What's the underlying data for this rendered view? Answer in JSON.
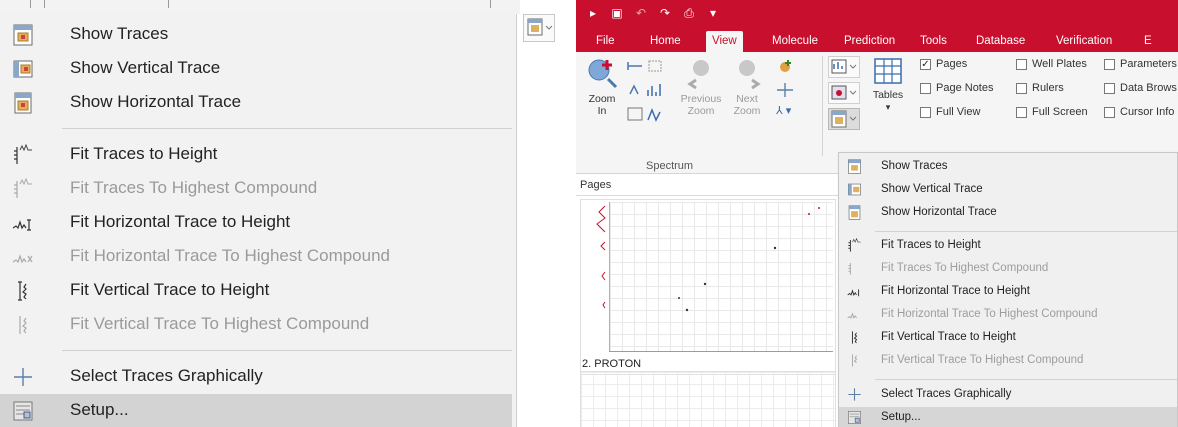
{
  "left_menu": {
    "items": [
      {
        "label": "Show Traces",
        "icon": "show-traces-icon",
        "enabled": true
      },
      {
        "label": "Show Vertical Trace",
        "icon": "vertical-trace-icon",
        "enabled": true
      },
      {
        "label": "Show Horizontal Trace",
        "icon": "horizontal-trace-icon",
        "enabled": true
      },
      {
        "label": "Fit Traces to Height",
        "icon": "fit-traces-height-icon",
        "enabled": true
      },
      {
        "label": "Fit Traces To Highest Compound",
        "icon": "fit-traces-compound-icon",
        "enabled": false
      },
      {
        "label": "Fit Horizontal Trace to Height",
        "icon": "fit-horizontal-height-icon",
        "enabled": true
      },
      {
        "label": "Fit Horizontal Trace To Highest Compound",
        "icon": "fit-horizontal-compound-icon",
        "enabled": false
      },
      {
        "label": "Fit Vertical Trace to Height",
        "icon": "fit-vertical-height-icon",
        "enabled": true
      },
      {
        "label": "Fit Vertical Trace To Highest Compound",
        "icon": "fit-vertical-compound-icon",
        "enabled": false
      },
      {
        "label": "Select Traces Graphically",
        "icon": "crosshair-icon",
        "enabled": true
      },
      {
        "label": "Setup...",
        "icon": "setup-icon",
        "enabled": true,
        "highlighted": true
      }
    ]
  },
  "app": {
    "tabs": [
      "File",
      "Home",
      "View",
      "Molecule",
      "Prediction",
      "Tools",
      "Database",
      "Verification",
      "E"
    ],
    "active_tab": "View",
    "ribbon": {
      "zoom_in_label": "Zoom\nIn",
      "previous_zoom_label": "Previous\nZoom",
      "next_zoom_label": "Next\nZoom",
      "group_label": "Spectrum",
      "tables_label": "Tables",
      "checkboxes": [
        {
          "label": "Pages",
          "checked": true
        },
        {
          "label": "Well Plates",
          "checked": false
        },
        {
          "label": "Parameters",
          "checked": false
        },
        {
          "label": "Page Notes",
          "checked": false
        },
        {
          "label": "Rulers",
          "checked": false
        },
        {
          "label": "Data Brows",
          "checked": false
        },
        {
          "label": "Full View",
          "checked": false
        },
        {
          "label": "Full Screen",
          "checked": false
        },
        {
          "label": "Cursor Info",
          "checked": false
        }
      ]
    },
    "pages_pane": {
      "title": "Pages",
      "second_page_label": "2. PROTON"
    },
    "menu": {
      "items": [
        {
          "label": "Show Traces",
          "enabled": true
        },
        {
          "label": "Show Vertical Trace",
          "enabled": true
        },
        {
          "label": "Show Horizontal Trace",
          "enabled": true
        },
        {
          "label": "Fit Traces to Height",
          "enabled": true
        },
        {
          "label": "Fit Traces To Highest Compound",
          "enabled": false
        },
        {
          "label": "Fit Horizontal Trace to Height",
          "enabled": true
        },
        {
          "label": "Fit Horizontal Trace To Highest Compound",
          "enabled": false
        },
        {
          "label": "Fit Vertical Trace to Height",
          "enabled": true
        },
        {
          "label": "Fit Vertical Trace To Highest Compound",
          "enabled": false
        },
        {
          "label": "Select Traces Graphically",
          "enabled": true
        },
        {
          "label": "Setup...",
          "enabled": true,
          "highlighted": true
        }
      ]
    }
  },
  "colors": {
    "brand_red": "#c8102e",
    "menu_bg": "#f0f0f0",
    "highlight": "#d3d3d3",
    "disabled_text": "#9a9a9a"
  }
}
